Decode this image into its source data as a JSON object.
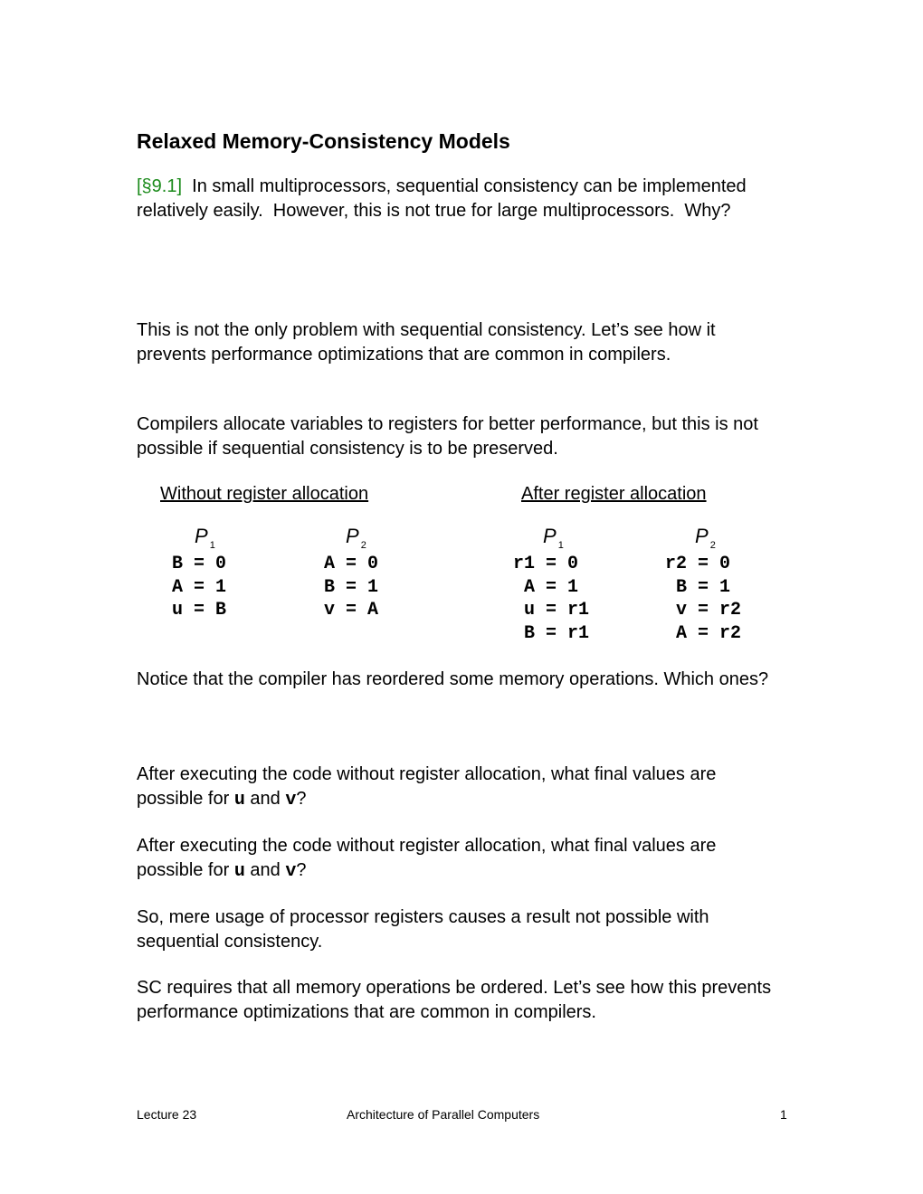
{
  "title": "Relaxed Memory-Consistency Models",
  "intro": {
    "ref": "[§9.1]",
    "text": "  In small multiprocessors, sequential consistency can be implemented relatively easily.  However, this is not true for large multiprocessors.  Why?"
  },
  "para2": "This is not the only problem with sequential consistency.  Let’s see how it prevents performance optimizations that are common in compilers.",
  "para3": "Compilers allocate variables to registers for better performance, but this is not possible if sequential consistency is to be preserved.",
  "code_table": {
    "without": {
      "heading": "Without register allocation",
      "p1_label": "P",
      "p1_sub": "1",
      "p2_label": "P",
      "p2_sub": "2",
      "p1_code": "B = 0\nA = 1\nu = B",
      "p2_code": "A = 0\nB = 1\nv = A"
    },
    "after": {
      "heading": "After register allocation",
      "p1_label": "P",
      "p1_sub": "1",
      "p2_label": "P",
      "p2_sub": "2",
      "p1_code": "r1 = 0\n A = 1\n u = r1\n B = r1",
      "p2_code": "r2 = 0\n B = 1\n v = r2\n A = r2"
    }
  },
  "para4": "Notice that the compiler has reordered some memory operations. Which ones?",
  "q1": {
    "pre": "After executing the code without register allocation, what final values are possible for ",
    "u": "u",
    "and": " and ",
    "v": "v",
    "post": "?"
  },
  "q2": {
    "pre": "After executing the code without register allocation, what final values are possible for ",
    "u": "u",
    "and": " and ",
    "v": "v",
    "post": "?"
  },
  "para5": "So, mere usage of processor registers causes a result not possible with sequential consistency.",
  "para6": "SC requires that all memory operations be ordered.  Let’s see how this prevents performance optimizations that are common in compilers.",
  "footer": {
    "left": "Lecture 23",
    "center": "Architecture of Parallel Computers",
    "page": "1"
  }
}
